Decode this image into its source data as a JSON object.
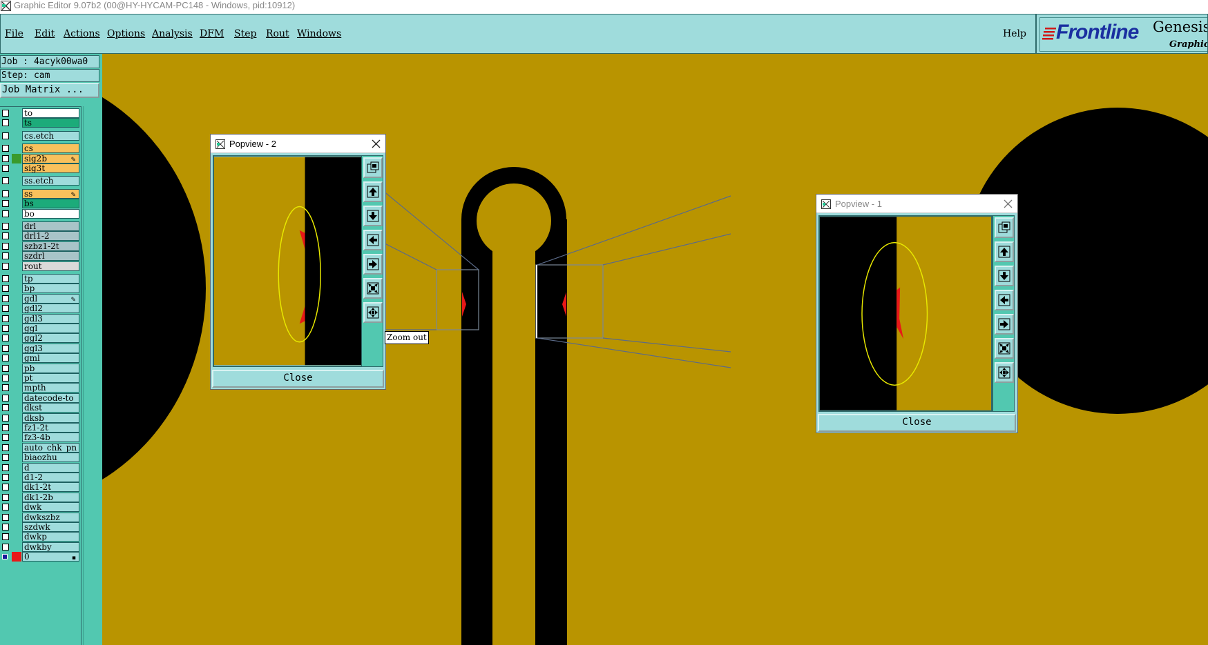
{
  "window": {
    "title": "Graphic Editor 9.07b2 (00@HY-HYCAM-PC148 - Windows, pid:10912)",
    "app_icon": "graphic-editor-icon"
  },
  "menubar": {
    "items": [
      "File",
      "Edit",
      "Actions",
      "Options",
      "Analysis",
      "DFM",
      "Step",
      "Rout",
      "Windows"
    ],
    "help": "Help"
  },
  "logo": {
    "brand": "Frontline",
    "product": "Genesis",
    "subtitle": "Graphic E"
  },
  "job": {
    "job_label": "Job : 4acyk00wa0",
    "step_label": "Step: cam",
    "matrix_button": "Job Matrix ..."
  },
  "layers": [
    {
      "name": "to",
      "type": "board"
    },
    {
      "name": "ts",
      "type": "mask"
    },
    {
      "name": "cs.etch",
      "type": "misc"
    },
    {
      "name": "cs",
      "type": "signal"
    },
    {
      "name": "sig2b",
      "type": "signal",
      "marked": true,
      "color": "#3a9a2a"
    },
    {
      "name": "sig3t",
      "type": "signal"
    },
    {
      "name": "ss.etch",
      "type": "misc"
    },
    {
      "name": "ss",
      "type": "signal",
      "marked": true
    },
    {
      "name": "bs",
      "type": "mask"
    },
    {
      "name": "bo",
      "type": "board"
    },
    {
      "name": "drl",
      "type": "drill"
    },
    {
      "name": "drl1-2",
      "type": "drill"
    },
    {
      "name": "szbz1-2t",
      "type": "drill"
    },
    {
      "name": "szdrl",
      "type": "drill"
    },
    {
      "name": "rout",
      "type": "rout"
    },
    {
      "name": "tp",
      "type": "misc"
    },
    {
      "name": "bp",
      "type": "misc"
    },
    {
      "name": "gdl",
      "type": "misc",
      "marked": true
    },
    {
      "name": "gdl2",
      "type": "misc"
    },
    {
      "name": "gdl3",
      "type": "misc"
    },
    {
      "name": "ggl",
      "type": "misc"
    },
    {
      "name": "ggl2",
      "type": "misc"
    },
    {
      "name": "ggl3",
      "type": "misc"
    },
    {
      "name": "gml",
      "type": "misc"
    },
    {
      "name": "pb",
      "type": "misc"
    },
    {
      "name": "pt",
      "type": "misc"
    },
    {
      "name": "mpth",
      "type": "misc"
    },
    {
      "name": "datecode-to",
      "type": "misc"
    },
    {
      "name": "dkst",
      "type": "misc"
    },
    {
      "name": "dksb",
      "type": "misc"
    },
    {
      "name": "fz1-2t",
      "type": "misc"
    },
    {
      "name": "fz3-4b",
      "type": "misc"
    },
    {
      "name": "auto_chk_pn",
      "type": "misc"
    },
    {
      "name": "biaozhu",
      "type": "misc"
    },
    {
      "name": "d",
      "type": "misc"
    },
    {
      "name": "d1-2",
      "type": "misc"
    },
    {
      "name": "dk1-2t",
      "type": "misc"
    },
    {
      "name": "dk1-2b",
      "type": "misc"
    },
    {
      "name": "dwk",
      "type": "misc"
    },
    {
      "name": "dwkszbz",
      "type": "misc"
    },
    {
      "name": "szdwk",
      "type": "misc"
    },
    {
      "name": "dwkp",
      "type": "misc"
    },
    {
      "name": "dwkby",
      "type": "misc"
    },
    {
      "name": "0",
      "type": "misc",
      "active": true
    }
  ],
  "colors": {
    "copper": "#b99400",
    "laminate": "#000000",
    "highlight_ellipse": "#e8e800",
    "defect": "#e81818",
    "panel": "#9fdcdc",
    "panel_dark": "#52c8b0"
  },
  "popviews": [
    {
      "title": "Popview - 2",
      "close_label": "Close",
      "active": true
    },
    {
      "title": "Popview - 1",
      "close_label": "Close",
      "active": false
    }
  ],
  "popview_tools": [
    "zoom-home-icon",
    "pan-up-icon",
    "pan-down-icon",
    "pan-left-icon",
    "pan-right-icon",
    "zoom-in-icon",
    "zoom-out-icon"
  ],
  "tooltip": "Zoom out"
}
